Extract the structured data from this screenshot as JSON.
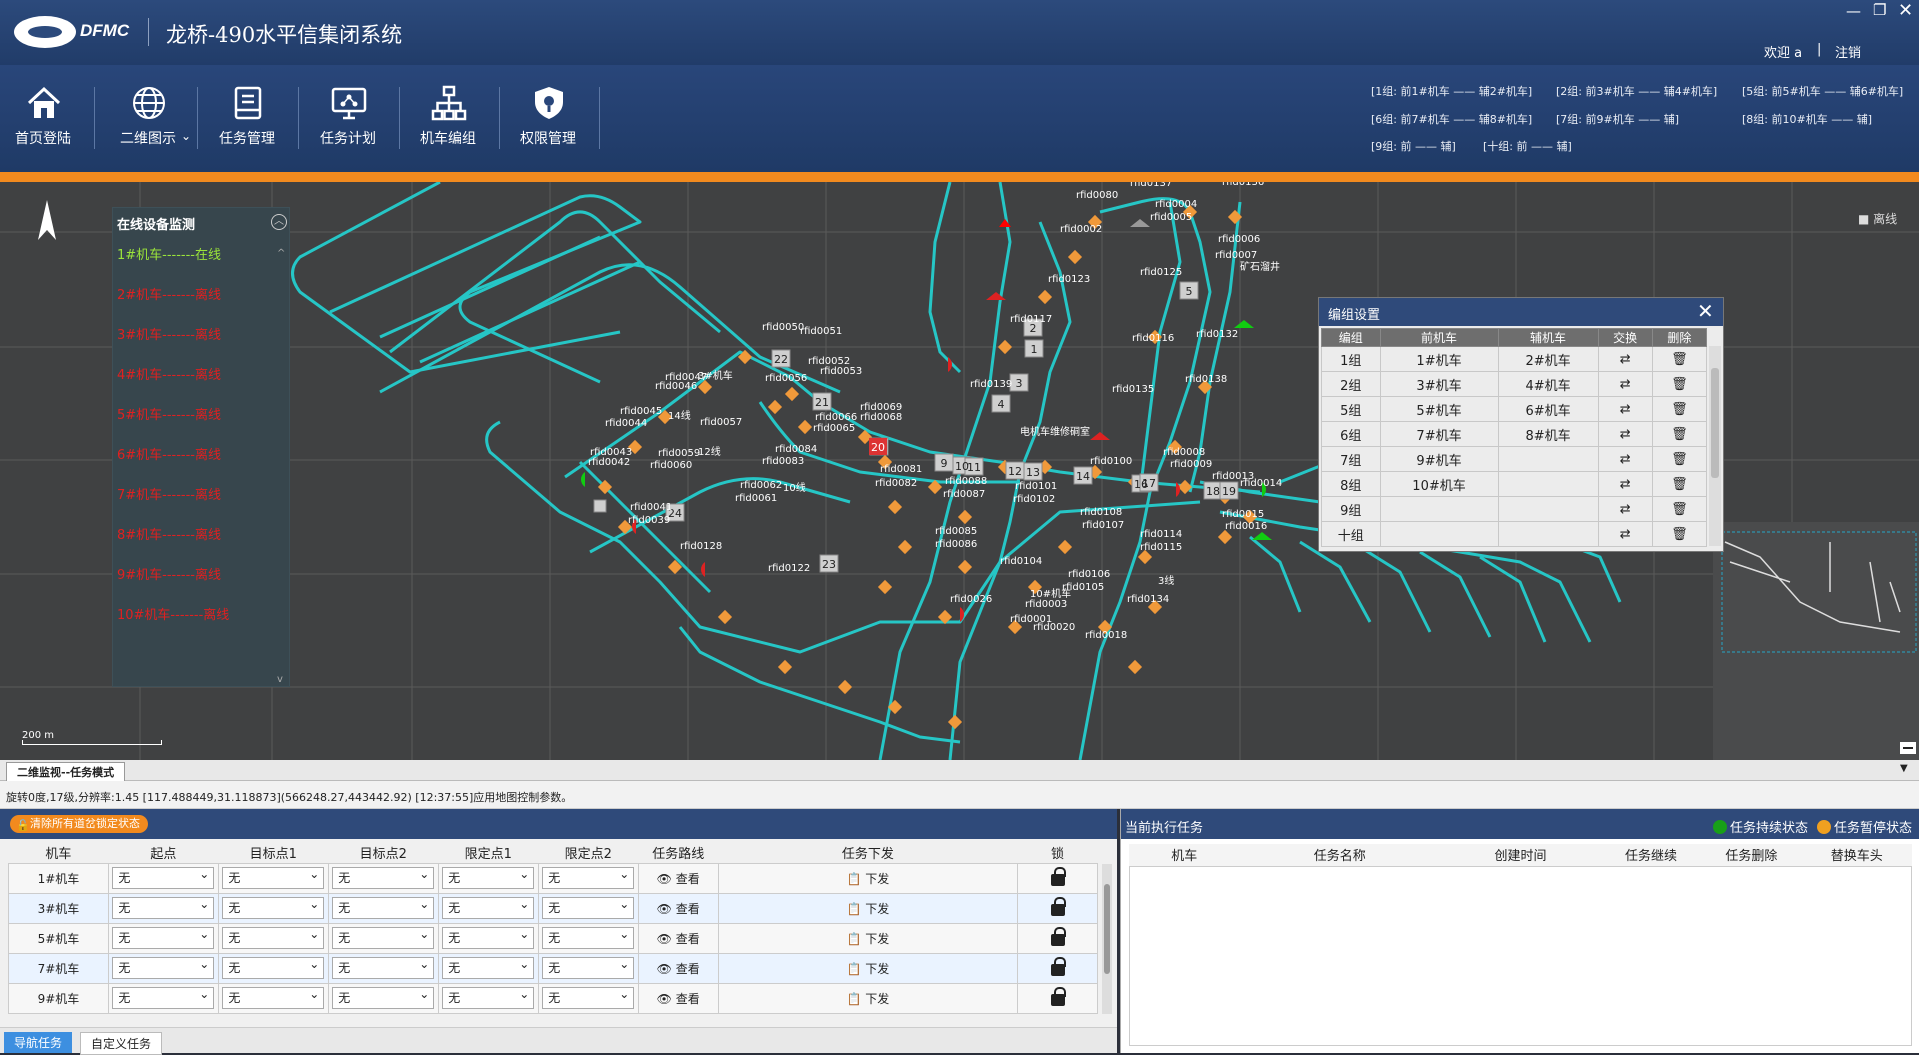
{
  "header": {
    "brand": "DFMC",
    "app_title": "龙桥-490水平信集闭系统",
    "welcome": "欢迎 a",
    "separator": "|",
    "logout": "注销"
  },
  "toolbar": {
    "items": [
      {
        "label": "首页登陆",
        "icon": "home-icon"
      },
      {
        "label": "二维图示",
        "icon": "globe-icon"
      },
      {
        "label": "任务管理",
        "icon": "document-icon"
      },
      {
        "label": "任务计划",
        "icon": "monitor-plan-icon"
      },
      {
        "label": "机车编组",
        "icon": "org-chart-icon"
      },
      {
        "label": "权限管理",
        "icon": "shield-icon"
      }
    ],
    "groups": [
      "[1组: 前1#机车 —— 辅2#机车]",
      "[2组: 前3#机车 —— 辅4#机车]",
      "[5组: 前5#机车 —— 辅6#机车]",
      "[6组: 前7#机车 —— 辅8#机车]",
      "[7组: 前9#机车 —— 辅]",
      "[8组: 前10#机车 —— 辅]",
      "[9组: 前 —— 辅]",
      "[十组: 前 —— 辅]"
    ]
  },
  "map": {
    "monitor_title": "在线设备监测",
    "devices": [
      {
        "text": "1#机车-------在线",
        "status": "online"
      },
      {
        "text": "2#机车-------离线",
        "status": "offline"
      },
      {
        "text": "3#机车-------离线",
        "status": "offline"
      },
      {
        "text": "4#机车-------离线",
        "status": "offline"
      },
      {
        "text": "5#机车-------离线",
        "status": "offline"
      },
      {
        "text": "6#机车-------离线",
        "status": "offline"
      },
      {
        "text": "7#机车-------离线",
        "status": "offline"
      },
      {
        "text": "8#机车-------离线",
        "status": "offline"
      },
      {
        "text": "9#机车-------离线",
        "status": "offline"
      },
      {
        "text": "10#机车-------离线",
        "status": "offline"
      }
    ],
    "legend_offline": "■ 离线",
    "scale_label": "200 m",
    "labels": [
      "rfid0137",
      "rfid0131",
      "rfid0136",
      "rfid0080",
      "rfid0004",
      "rfid0005",
      "rfid0002",
      "rfid0006",
      "rfid0007",
      "矿石溜井",
      "rfid0123",
      "rfid0125",
      "rfid0117",
      "rfid0116",
      "rfid0132",
      "rfid0139",
      "rfid0135",
      "rfid0138",
      "电机车维修硐室",
      "rfid0050",
      "rfid0051",
      "rfid0052",
      "rfid0053",
      "rfid0056",
      "rfid0047",
      "rfid0046",
      "rfid0045",
      "rfid0044",
      "rfid0057",
      "rfid0066",
      "rfid0065",
      "rfid0069",
      "rfid0068",
      "rfid0043",
      "rfid0042",
      "rfid0060",
      "rfid0059",
      "rfid0084",
      "rfid0083",
      "rfid0081",
      "rfid0082",
      "rfid0088",
      "rfid0087",
      "rfid0101",
      "rfid0102",
      "rfid0108",
      "rfid0107",
      "rfid0114",
      "rfid0115",
      "rfid0104",
      "rfid0106",
      "rfid0105",
      "rfid0134",
      "rfid0122",
      "rfid0128",
      "rfid0039",
      "rfid0041",
      "rfid0061",
      "rfid0062",
      "rfid0015",
      "rfid0016",
      "rfid0013",
      "rfid0014",
      "rfid0008",
      "rfid0009",
      "rfid0100",
      "rfid0085",
      "rfid0086",
      "rfid0003",
      "rfid0001",
      "rfid0018",
      "rfid0020",
      "rfid0026",
      "3#机车",
      "14线",
      "12线",
      "10线",
      "10#机车",
      "3线",
      "0线"
    ],
    "blocks": [
      "5",
      "1",
      "3",
      "4",
      "21",
      "22",
      "20",
      "9",
      "10",
      "11",
      "12",
      "13",
      "14",
      "15",
      "16",
      "17",
      "18",
      "19",
      "24",
      "23",
      "2"
    ]
  },
  "dialog": {
    "title": "编组设置",
    "columns": [
      "编组",
      "前机车",
      "辅机车",
      "交换",
      "删除"
    ],
    "rows": [
      {
        "group": "1组",
        "front": "1#机车",
        "aux": "2#机车"
      },
      {
        "group": "2组",
        "front": "3#机车",
        "aux": "4#机车"
      },
      {
        "group": "5组",
        "front": "5#机车",
        "aux": "6#机车"
      },
      {
        "group": "6组",
        "front": "7#机车",
        "aux": "8#机车"
      },
      {
        "group": "7组",
        "front": "9#机车",
        "aux": ""
      },
      {
        "group": "8组",
        "front": "10#机车",
        "aux": ""
      },
      {
        "group": "9组",
        "front": "",
        "aux": ""
      },
      {
        "group": "十组",
        "front": "",
        "aux": ""
      }
    ]
  },
  "tab_strip": {
    "label": "二维监视--任务模式"
  },
  "status_bar": "旋转0度,17级,分辨率:1.45  [117.488449,31.118873](566248.27,443442.92)  [12:37:55]应用地图控制参数。",
  "task_panel": {
    "clear_button": "清除所有道岔锁定状态",
    "columns": [
      "机车",
      "起点",
      "目标点1",
      "目标点2",
      "限定点1",
      "限定点2",
      "任务路线",
      "任务下发",
      "锁"
    ],
    "default_select": "无",
    "view_label": "查看",
    "dispatch_label": "下发",
    "rows": [
      "1#机车",
      "3#机车",
      "5#机车",
      "7#机车",
      "9#机车"
    ],
    "tabs": [
      "导航任务",
      "自定义任务"
    ]
  },
  "current_tasks": {
    "title": "当前执行任务",
    "legend_continue": "任务持续状态",
    "legend_pause": "任务暂停状态",
    "columns": [
      "机车",
      "任务名称",
      "创建时间",
      "任务继续",
      "任务删除",
      "替换车头"
    ],
    "colors": {
      "continue": "#18a018",
      "pause": "#f0a020"
    }
  }
}
